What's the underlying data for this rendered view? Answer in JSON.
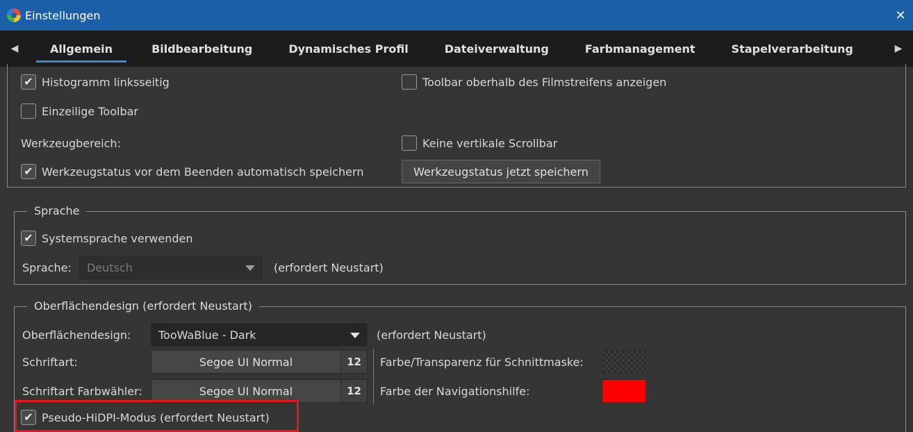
{
  "window": {
    "title": "Einstellungen",
    "close_glyph": "✕"
  },
  "tabs": [
    {
      "label": "Allgemein",
      "active": true
    },
    {
      "label": "Bildbearbeitung",
      "active": false
    },
    {
      "label": "Dynamisches Profil",
      "active": false
    },
    {
      "label": "Dateiverwaltung",
      "active": false
    },
    {
      "label": "Farbmanagement",
      "active": false
    },
    {
      "label": "Stapelverarbeitung",
      "active": false
    }
  ],
  "workspace": {
    "histogram_left": {
      "label": "Histogramm linksseitig",
      "checked": true
    },
    "toolbar_above_filmstrip": {
      "label": "Toolbar oberhalb des Filmstreifens anzeigen",
      "checked": false
    },
    "single_row_toolbar": {
      "label": "Einzeilige Toolbar",
      "checked": false
    },
    "tool_area_label": "Werkzeugbereich:",
    "no_vertical_scrollbar": {
      "label": "Keine vertikale Scrollbar",
      "checked": false
    },
    "autosave_tool_state": {
      "label": "Werkzeugstatus vor dem Beenden automatisch speichern",
      "checked": true
    },
    "save_tool_state_now": "Werkzeugstatus jetzt speichern"
  },
  "language": {
    "legend": "Sprache",
    "use_system_language": {
      "label": "Systemsprache verwenden",
      "checked": true
    },
    "language_label": "Sprache:",
    "language_value": "Deutsch",
    "restart_note": "(erfordert Neustart)"
  },
  "theme": {
    "legend": "Oberflächendesign (erfordert Neustart)",
    "theme_label": "Oberflächendesign:",
    "theme_value": "TooWaBlue - Dark",
    "theme_restart_note": "(erfordert Neustart)",
    "font_label": "Schriftart:",
    "font_name": "Segoe UI Normal",
    "font_size": "12",
    "colorpicker_font_label": "Schriftart Farbwähler:",
    "colorpicker_font_name": "Segoe UI Normal",
    "colorpicker_font_size": "12",
    "cropmask_color_label": "Farbe/Transparenz für Schnittmaske:",
    "nav_color_label": "Farbe der Navigationshilfe:",
    "nav_color": "#ff0000",
    "pseudo_hidpi": {
      "label": "Pseudo-HiDPI-Modus (erfordert Neustart)",
      "checked": true
    }
  },
  "colors": {
    "titlebar": "#1a5fa8",
    "tab_underline": "#3d8bd8",
    "highlight": "#e8141b"
  }
}
